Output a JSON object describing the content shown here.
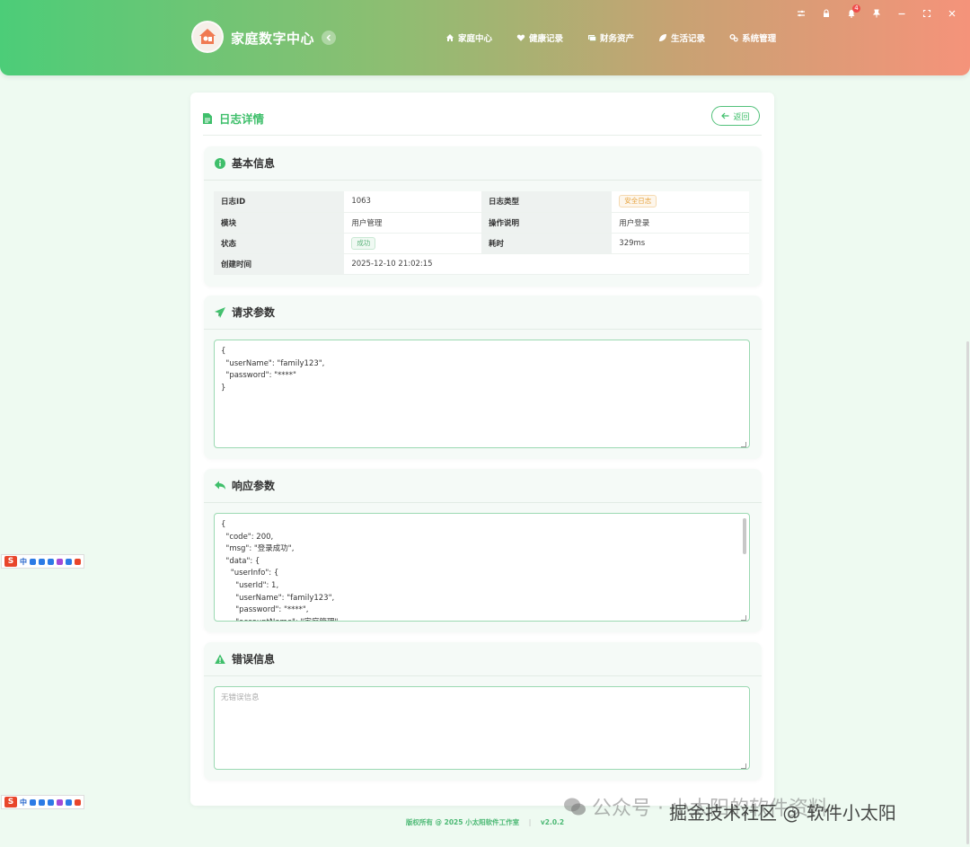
{
  "header": {
    "brand": "家庭数字中心",
    "nav": [
      {
        "label": "家庭中心",
        "icon": "home-icon"
      },
      {
        "label": "健康记录",
        "icon": "heart-icon"
      },
      {
        "label": "财务资产",
        "icon": "money-icon"
      },
      {
        "label": "生活记录",
        "icon": "leaf-icon"
      },
      {
        "label": "系统管理",
        "icon": "gears-icon"
      }
    ],
    "notification_count": "4"
  },
  "page": {
    "title": "日志详情",
    "back_label": "返回"
  },
  "basic_info": {
    "title": "基本信息",
    "rows": [
      {
        "k1": "日志ID",
        "v1": "1063",
        "k2": "日志类型",
        "v2": "安全日志"
      },
      {
        "k1": "模块",
        "v1": "用户管理",
        "k2": "操作说明",
        "v2": "用户登录"
      },
      {
        "k1": "状态",
        "v1": "成功",
        "k2": "耗时",
        "v2": "329ms"
      },
      {
        "k1": "创建时间",
        "v1": "2025-12-10 21:02:15",
        "k2": "",
        "v2": ""
      }
    ]
  },
  "request": {
    "title": "请求参数",
    "content": "{\n  \"userName\": \"family123\",\n  \"password\": \"****\"\n}"
  },
  "response": {
    "title": "响应参数",
    "content": "{\n  \"code\": 200,\n  \"msg\": \"登录成功\",\n  \"data\": {\n    \"userInfo\": {\n      \"userId\": 1,\n      \"userName\": \"family123\",\n      \"password\": \"****\",\n      \"accountName\": \"家庭管理\""
  },
  "error": {
    "title": "错误信息",
    "placeholder": "无错误信息"
  },
  "footer": {
    "copyright": "版权所有 @ 2025 小太阳软件工作室",
    "version": "v2.0.2"
  },
  "ime": {
    "label": "中"
  },
  "watermark": {
    "wechat": "公众号 · 小太阳的软件资料",
    "juejin": "掘金技术社区 @ 软件小太阳"
  },
  "colors": {
    "accent": "#3fbf6b",
    "header_start": "#4ccd78",
    "header_end": "#f5937a",
    "warn_tag": "#e6a23c"
  }
}
